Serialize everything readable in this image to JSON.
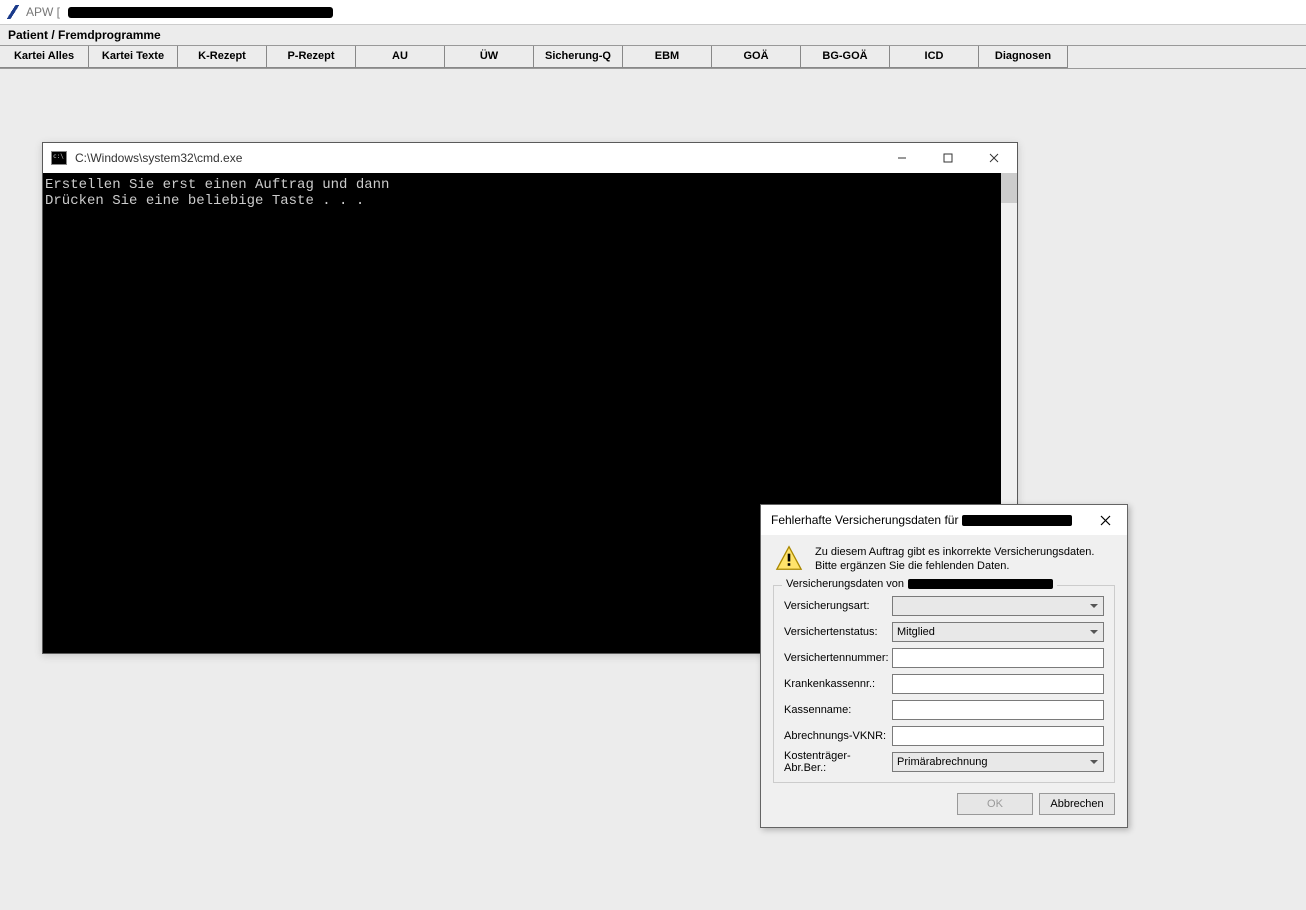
{
  "app": {
    "title_prefix": "APW ["
  },
  "menu": {
    "item": "Patient / Fremdprogramme"
  },
  "toolbar": {
    "buttons": [
      "Kartei Alles",
      "Kartei Texte",
      "K-Rezept",
      "P-Rezept",
      "AU",
      "ÜW",
      "Sicherung-Q",
      "EBM",
      "GOÄ",
      "BG-GOÄ",
      "ICD",
      "Diagnosen"
    ]
  },
  "cmd": {
    "title": "C:\\Windows\\system32\\cmd.exe",
    "line1": "Erstellen Sie erst einen Auftrag und dann",
    "line2": "Drücken Sie eine beliebige Taste . . ."
  },
  "dialog": {
    "title_prefix": "Fehlerhafte Versicherungsdaten für",
    "msg_l1": "Zu diesem Auftrag gibt es inkorrekte Versicherungsdaten.",
    "msg_l2": "Bitte ergänzen Sie die fehlenden Daten.",
    "group_legend_prefix": "Versicherungsdaten von",
    "fields": {
      "versicherungsart": {
        "label": "Versicherungsart:",
        "value": ""
      },
      "versichertenstatus": {
        "label": "Versichertenstatus:",
        "value": "Mitglied"
      },
      "versichertennummer": {
        "label": "Versichertennummer:",
        "value": ""
      },
      "krankenkassennr": {
        "label": "Krankenkassennr.:",
        "value": ""
      },
      "kassenname": {
        "label": "Kassenname:",
        "value": ""
      },
      "abrechnungs_vknr": {
        "label": "Abrechnungs-VKNR:",
        "value": ""
      },
      "kostentraeger": {
        "label": "Kostenträger-Abr.Ber.:",
        "value": "Primärabrechnung"
      }
    },
    "buttons": {
      "ok": "OK",
      "cancel": "Abbrechen"
    }
  }
}
